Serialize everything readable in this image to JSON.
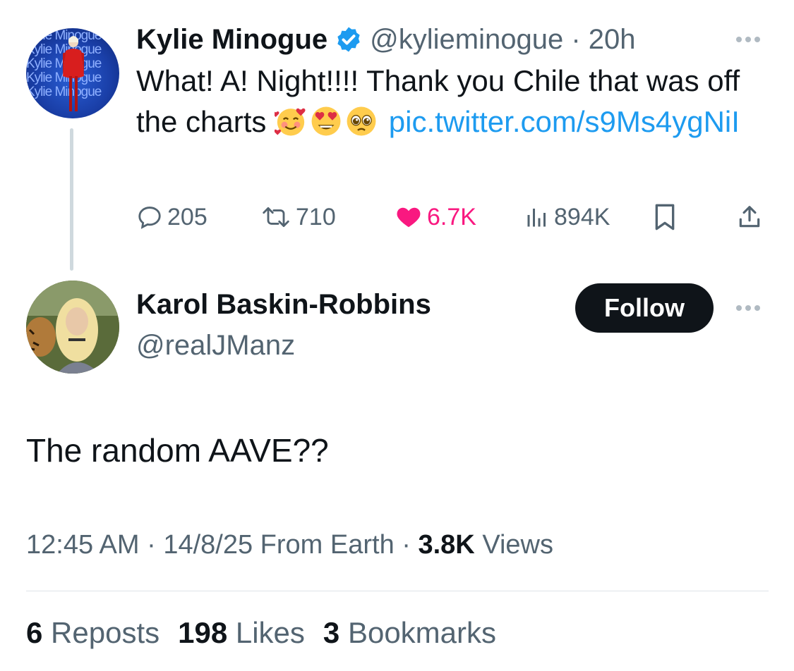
{
  "parent_tweet": {
    "avatar_watermark_lines": [
      "Kylie Minogue",
      "Kylie Minogue",
      "Kylie Minogue",
      "Kylie Minogue",
      "Kylie Minogue"
    ],
    "display_name": "Kylie Minogue",
    "verified": true,
    "handle_time": "@kylieminogue · 20h",
    "text_before_emoji": "What! A! Night!!!! Thank you Chile that was off the charts ",
    "emojis": [
      "smiling-face-with-hearts",
      "heart-eyes",
      "pleading-face"
    ],
    "link_text": "pic.twitter.com/s9Ms4ygNiI",
    "actions": {
      "replies": "205",
      "reposts": "710",
      "likes": "6.7K",
      "views": "894K"
    },
    "accent_color": "#1d9bf0",
    "like_color": "#f91880"
  },
  "reply_tweet": {
    "display_name": "Karol Baskin-Robbins",
    "handle": "@realJManz",
    "follow_label": "Follow",
    "text": "The random AAVE??",
    "meta": {
      "time_date": "12:45 AM · 14/8/25 From Earth · ",
      "views_count": "3.8K",
      "views_label": " Views"
    },
    "stats": {
      "reposts_count": "6",
      "reposts_label": "Reposts",
      "likes_count": "198",
      "likes_label": "Likes",
      "bookmarks_count": "3",
      "bookmarks_label": "Bookmarks"
    }
  }
}
